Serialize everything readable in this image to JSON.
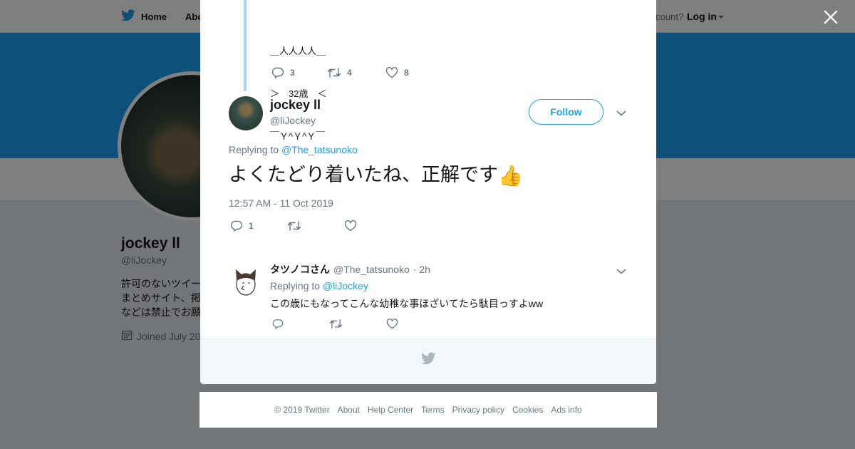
{
  "nav": {
    "home_label": "Home",
    "about_label": "Abo",
    "account_prompt": "Account?",
    "login_label": "Log in"
  },
  "profile": {
    "name": "jockey ll",
    "handle": "@liJockey",
    "bio_lines": [
      "許可のないツイー",
      "まとめサイト、掲",
      "などは禁止でお願"
    ],
    "joined": "Joined July 20"
  },
  "thread": {
    "prev_tweet": {
      "aa_lines": [
        "＿人人人人＿",
        "＞　32歳　＜",
        "￣Ｙ^Ｙ^Ｙ￣"
      ],
      "replies": "3",
      "retweets": "4",
      "likes": "8"
    },
    "main_tweet": {
      "name": "jockey ll",
      "handle": "@liJockey",
      "follow_label": "Follow",
      "replying_prefix": "Replying to",
      "replying_to": "@The_tatsunoko",
      "text": "よくたどり着いたね、正解です",
      "emoji": "👍",
      "timestamp": "12:57 AM - 11 Oct 2019",
      "replies": "1",
      "retweets": "",
      "likes": ""
    },
    "reply_tweet": {
      "name": "タツノコさん",
      "handle": "@The_tatsunoko",
      "time": "· 2h",
      "replying_prefix": "Replying to",
      "replying_to": "@liJockey",
      "text": "この歳にもなってこんな幼稚な事ほざいてたら駄目っすよww"
    }
  },
  "footer": {
    "links": [
      "© 2019 Twitter",
      "About",
      "Help Center",
      "Terms",
      "Privacy policy",
      "Cookies",
      "Ads info"
    ]
  },
  "colors": {
    "brand_blue": "#1da1f2",
    "thread_line": "#a5d7f7",
    "muted_text": "#657786"
  }
}
